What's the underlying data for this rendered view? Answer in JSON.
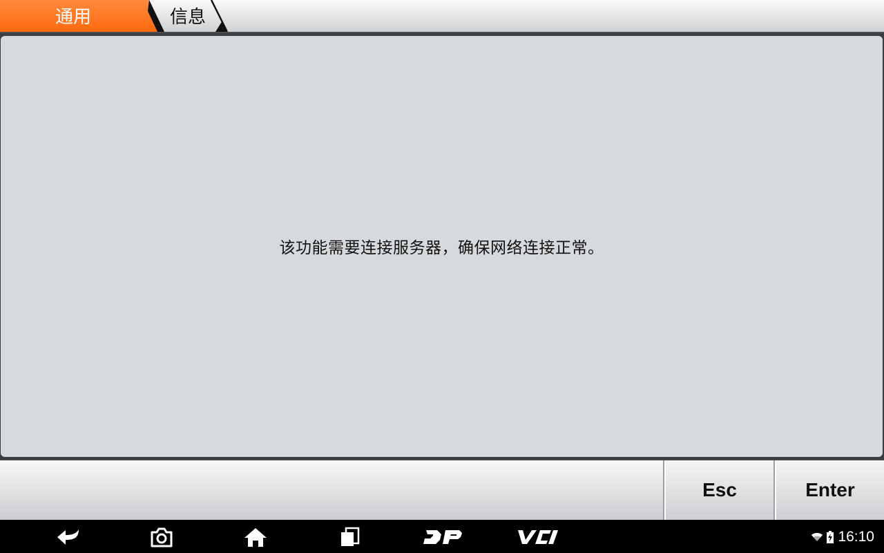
{
  "breadcrumb": {
    "items": [
      {
        "label": "通用"
      },
      {
        "label": "信息"
      }
    ]
  },
  "message": "该功能需要连接服务器，确保网络连接正常。",
  "actions": {
    "esc_label": "Esc",
    "enter_label": "Enter"
  },
  "nav": {
    "icons": [
      "back-icon",
      "screenshot-icon",
      "home-icon",
      "recent-apps-icon",
      "dp-icon",
      "vci-icon"
    ]
  },
  "status": {
    "time": "16:10",
    "icons": [
      "wifi-icon",
      "battery-charging-icon"
    ]
  },
  "colors": {
    "accent": "#ff6a10",
    "panel": "#d7dadd",
    "nav_bg": "#000000"
  }
}
